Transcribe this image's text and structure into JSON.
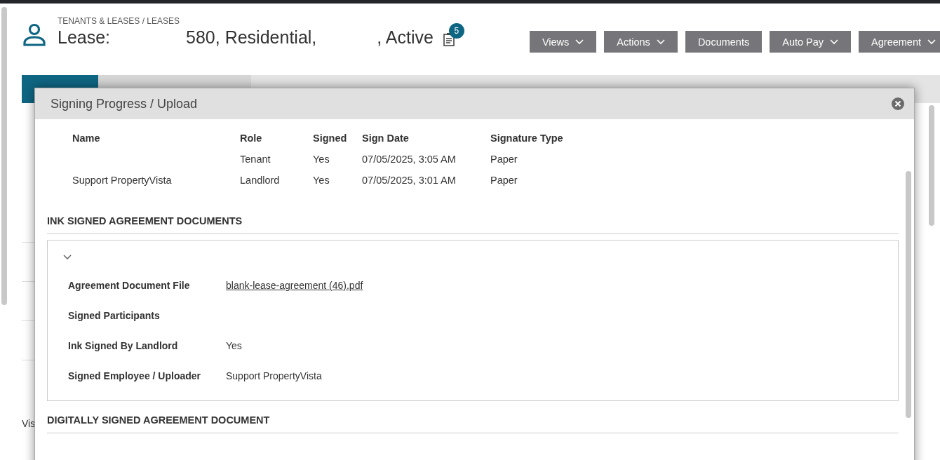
{
  "breadcrumb": "TENANTS & LEASES / LEASES",
  "title": {
    "prefix": "Lease:",
    "middle": "580, Residential,",
    "suffix": ", Active",
    "badge": "5"
  },
  "toolbar": [
    {
      "label": "Views",
      "dropdown": true
    },
    {
      "label": "Actions",
      "dropdown": true
    },
    {
      "label": "Documents",
      "dropdown": false
    },
    {
      "label": "Auto Pay",
      "dropdown": true
    },
    {
      "label": "Agreement",
      "dropdown": true
    }
  ],
  "tabs": [
    {
      "selected": true
    },
    {
      "selected": false
    },
    {
      "selected": false
    }
  ],
  "background_text": "Vis",
  "modal": {
    "title": "Signing Progress / Upload",
    "signers": {
      "columns": [
        "Name",
        "Role",
        "Signed",
        "Sign Date",
        "Signature Type"
      ],
      "rows": [
        {
          "role": "Tenant",
          "signed": "Yes",
          "sign_date": "07/05/2025, 3:05 AM",
          "signature_type": "Paper"
        },
        {
          "name": "Support PropertyVista",
          "role": "Landlord",
          "signed": "Yes",
          "sign_date": "07/05/2025, 3:01 AM",
          "signature_type": "Paper"
        }
      ]
    },
    "ink_section": {
      "heading": "INK SIGNED AGREEMENT DOCUMENTS",
      "expanded": true,
      "fields": [
        {
          "label": "Agreement Document File",
          "value": "blank-lease-agreement (46).pdf",
          "kind": "link"
        },
        {
          "label": "Signed Participants",
          "kind": "text"
        },
        {
          "label": "Ink Signed By Landlord",
          "value": "Yes",
          "kind": "text"
        },
        {
          "label": "Signed Employee / Uploader",
          "value": "Support PropertyVista",
          "kind": "text"
        }
      ]
    },
    "digital_section": {
      "heading": "DIGITALLY SIGNED AGREEMENT DOCUMENT"
    }
  }
}
